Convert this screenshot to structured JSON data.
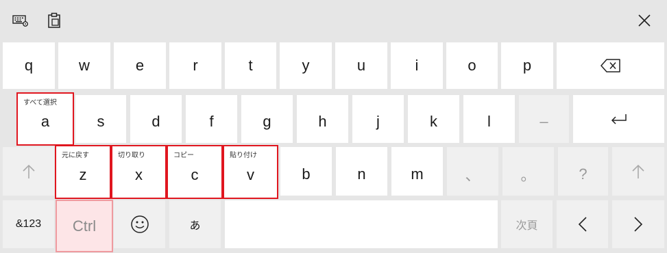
{
  "toolbar": {
    "keyboard_settings_icon": "keyboard-settings-icon",
    "clipboard_icon": "clipboard-icon",
    "close_icon": "close-icon"
  },
  "rows": {
    "row1": [
      "q",
      "w",
      "e",
      "r",
      "t",
      "y",
      "u",
      "i",
      "o",
      "p"
    ],
    "row2": [
      "a",
      "s",
      "d",
      "f",
      "g",
      "h",
      "j",
      "k",
      "l",
      "–"
    ],
    "row3": [
      "z",
      "x",
      "c",
      "v",
      "b",
      "n",
      "m",
      "、",
      "。",
      "?"
    ]
  },
  "hints": {
    "a": "すべて選択",
    "z": "元に戻す",
    "x": "切り取り",
    "c": "コピー",
    "v": "貼り付け"
  },
  "bottom": {
    "numbers": "&123",
    "ctrl": "Ctrl",
    "hiragana": "あ",
    "next_page": "次頁"
  },
  "colors": {
    "highlight": "#e0161f",
    "ctrl_fill": "#fde5e7"
  }
}
